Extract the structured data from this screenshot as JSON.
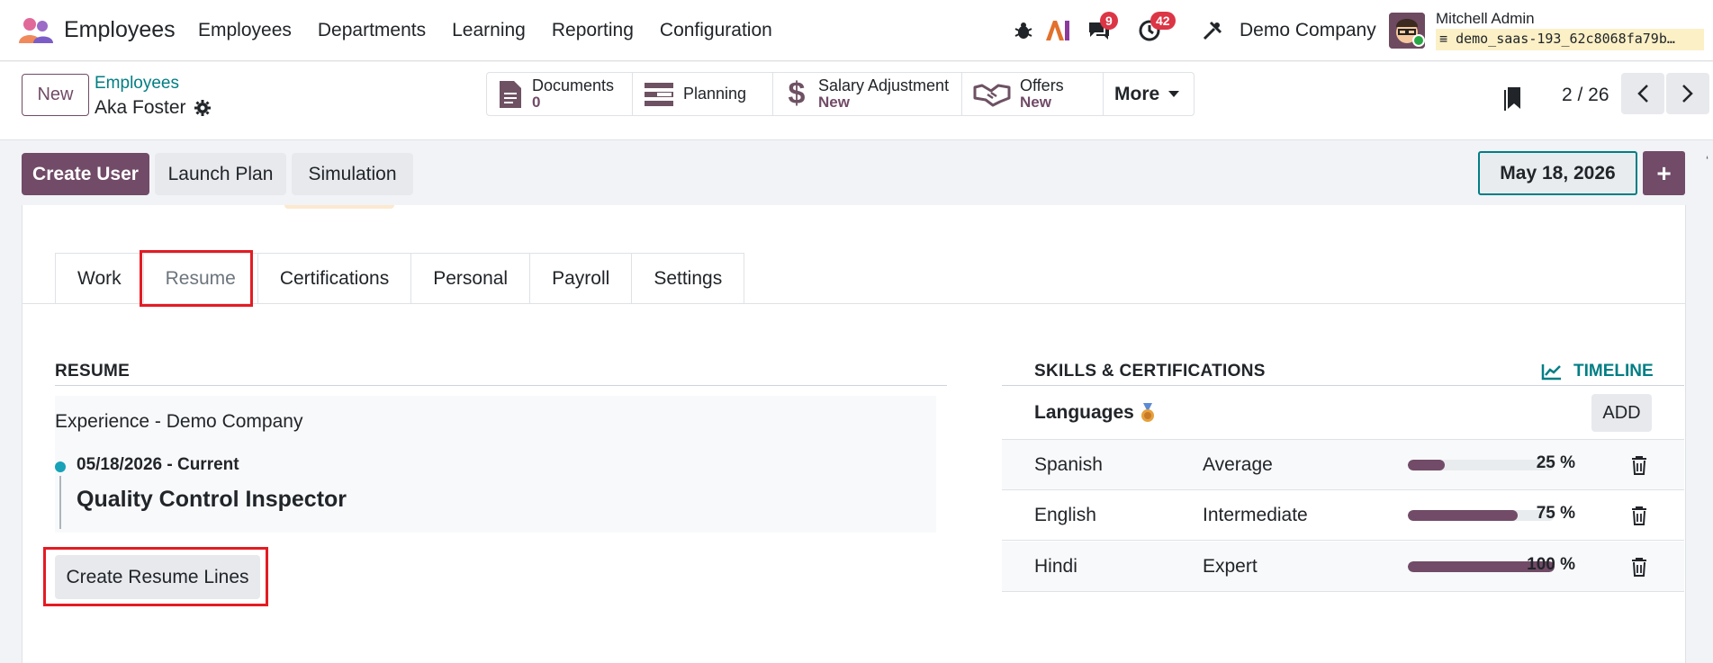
{
  "navbar": {
    "app_name": "Employees",
    "menu": [
      "Employees",
      "Departments",
      "Learning",
      "Reporting",
      "Configuration"
    ],
    "ai_label": "AI",
    "messages_count": "9",
    "activities_count": "42",
    "company": "Demo Company",
    "user_name": "Mitchell Admin",
    "database": "demo_saas-193_62c8068fa79b…"
  },
  "control": {
    "new_label": "New",
    "breadcrumb_parent": "Employees",
    "breadcrumb_current": "Aka Foster",
    "smart_buttons": {
      "documents_label": "Documents",
      "documents_count": "0",
      "planning_label": "Planning",
      "salary_label": "Salary Adjustment",
      "salary_sub": "New",
      "offers_label": "Offers",
      "offers_sub": "New",
      "more_label": "More"
    },
    "pager": "2 / 26"
  },
  "actions": {
    "create_user": "Create User",
    "launch_plan": "Launch Plan",
    "simulation": "Simulation",
    "date": "May 18, 2026",
    "plus": "+"
  },
  "tabs": [
    "Work",
    "Resume",
    "Certifications",
    "Personal",
    "Payroll",
    "Settings"
  ],
  "resume": {
    "title": "RESUME",
    "group": "Experience - Demo Company",
    "entry_date": "05/18/2026 - Current",
    "entry_role": "Quality Control Inspector",
    "create_lines": "Create Resume Lines"
  },
  "skills": {
    "title": "SKILLS & CERTIFICATIONS",
    "timeline": "TIMELINE",
    "category": "Languages",
    "add": "ADD",
    "rows": [
      {
        "name": "Spanish",
        "level": "Average",
        "pct_label": "25 %",
        "progress": 0.25
      },
      {
        "name": "English",
        "level": "Intermediate",
        "pct_label": "75 %",
        "progress": 0.75
      },
      {
        "name": "Hindi",
        "level": "Expert",
        "pct_label": "100 %",
        "progress": 1.0
      }
    ]
  },
  "colors": {
    "brand": "#714b67",
    "link": "#017e84",
    "highlight": "#e41b23",
    "badge": "#dc3545"
  }
}
